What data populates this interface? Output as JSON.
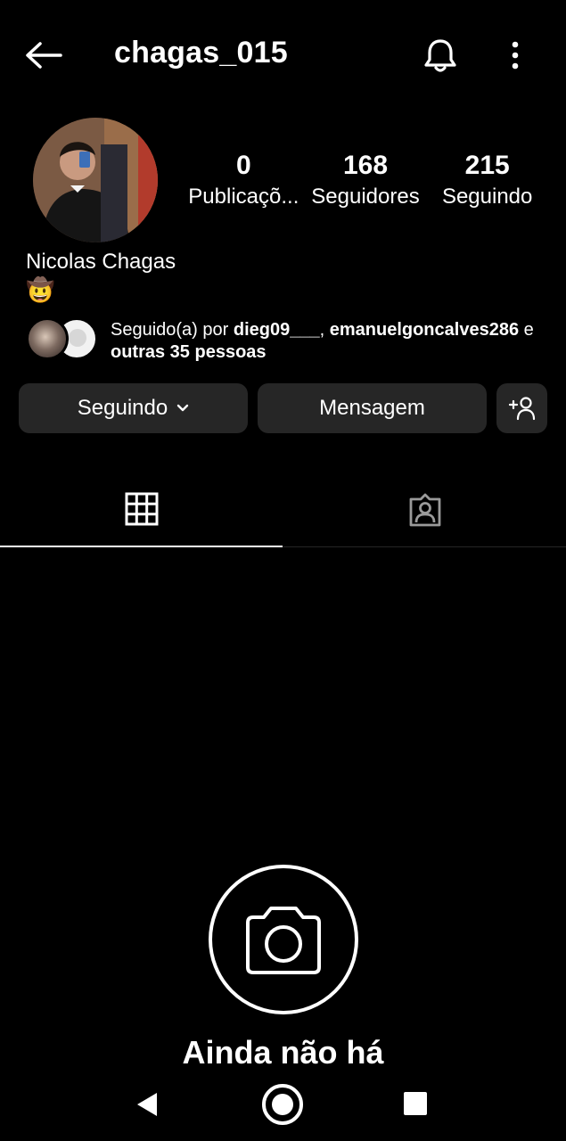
{
  "header": {
    "username": "chagas_015",
    "back_icon": "arrow-left-icon",
    "bell_icon": "bell-icon",
    "more_icon": "more-vertical-icon"
  },
  "profile": {
    "full_name": "Nicolas Chagas",
    "bio_emoji": "🤠",
    "stats": [
      {
        "value": "0",
        "label": "Publicaçõ..."
      },
      {
        "value": "168",
        "label": "Seguidores"
      },
      {
        "value": "215",
        "label": "Seguindo"
      }
    ]
  },
  "followed_by": {
    "prefix": "Seguido(a) por ",
    "user1": "dieg09___",
    "separator": ", ",
    "user2": "emanuelgoncalves286",
    "joiner": " e ",
    "others": "outras 35 pessoas"
  },
  "actions": {
    "following_label": "Seguindo",
    "message_label": "Mensagem",
    "add_icon": "add-person-icon"
  },
  "tabs": [
    {
      "icon": "grid-icon",
      "active": true
    },
    {
      "icon": "tagged-person-icon",
      "active": false
    }
  ],
  "empty_state": {
    "icon": "camera-icon",
    "title": "Ainda não há"
  },
  "system_nav": {
    "back_icon": "triangle-back-icon",
    "home_icon": "circle-home-icon",
    "recent_icon": "square-recent-icon"
  }
}
